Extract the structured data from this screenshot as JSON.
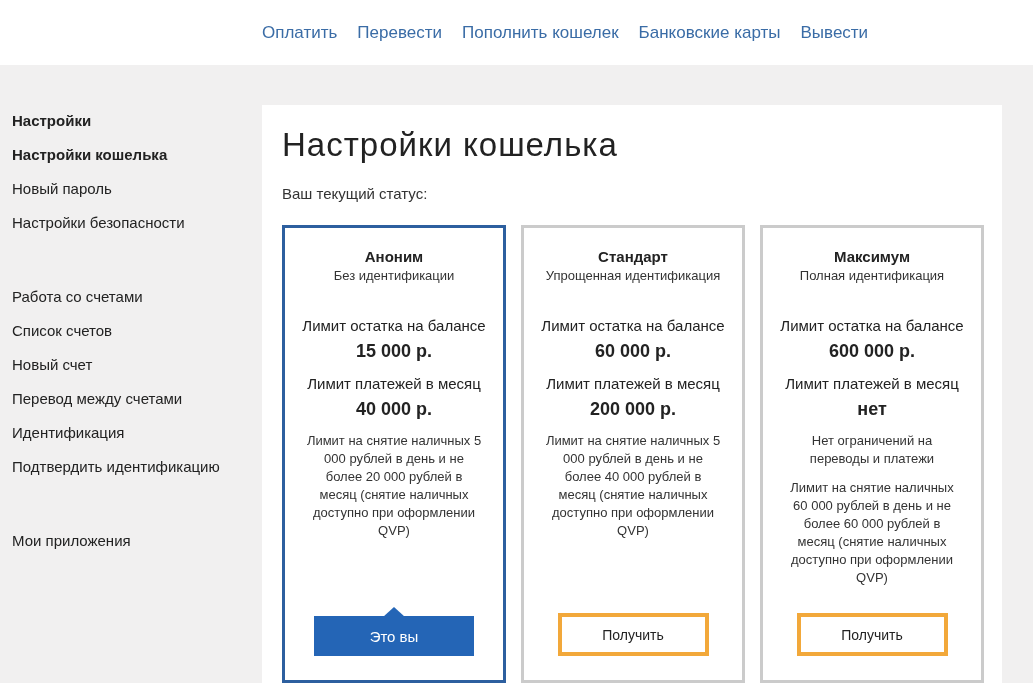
{
  "header": {
    "nav": [
      "Оплатить",
      "Перевести",
      "Пополнить кошелек",
      "Банковские карты",
      "Вывести"
    ]
  },
  "sidebar": {
    "sections": [
      {
        "title": "Настройки",
        "selected": true,
        "items": [
          {
            "label": "Настройки кошелька",
            "selected": true
          },
          {
            "label": "Новый пароль",
            "selected": false
          },
          {
            "label": "Настройки безопасности",
            "selected": false
          }
        ]
      },
      {
        "title": "Работа со счетами",
        "selected": false,
        "items": [
          {
            "label": "Список счетов",
            "selected": false
          },
          {
            "label": "Новый счет",
            "selected": false
          },
          {
            "label": "Перевод между счетами",
            "selected": false
          },
          {
            "label": "Идентификация",
            "selected": false
          },
          {
            "label": "Подтвердить идентификацию",
            "selected": false
          }
        ]
      },
      {
        "title": "Мои приложения",
        "selected": false
      }
    ]
  },
  "main": {
    "title": "Настройки кошелька",
    "status_label": "Ваш текущий статус:",
    "cards": [
      {
        "selected": true,
        "name": "Аноним",
        "subtitle": "Без идентификации",
        "balance_label": "Лимит остатка на балансе",
        "balance": "15 000 р.",
        "payments_label": "Лимит платежей в месяц",
        "payments": "40 000 р.",
        "notes": [
          "Лимит на снятие наличных 5 000 рублей в день и не более 20 000 рублей в месяц (снятие наличных доступно при оформлении QVP)"
        ],
        "button": "Это вы"
      },
      {
        "selected": false,
        "name": "Стандарт",
        "subtitle": "Упрощенная идентификация",
        "balance_label": "Лимит остатка на балансе",
        "balance": "60 000 р.",
        "payments_label": "Лимит платежей в месяц",
        "payments": "200 000 р.",
        "notes": [
          "Лимит на снятие наличных 5 000 рублей в день и не более 40 000 рублей в месяц (снятие наличных доступно при оформлении QVP)"
        ],
        "button": "Получить"
      },
      {
        "selected": false,
        "name": "Максимум",
        "subtitle": "Полная идентификация",
        "balance_label": "Лимит остатка на балансе",
        "balance": "600 000 р.",
        "payments_label": "Лимит платежей в месяц",
        "payments": "нет",
        "notes": [
          "Нет ограничений на переводы и платежи",
          "Лимит на снятие наличных 60 000 рублей в день и не более 60 000 рублей в месяц (снятие наличных доступно при оформлении QVP)"
        ],
        "button": "Получить"
      }
    ]
  }
}
